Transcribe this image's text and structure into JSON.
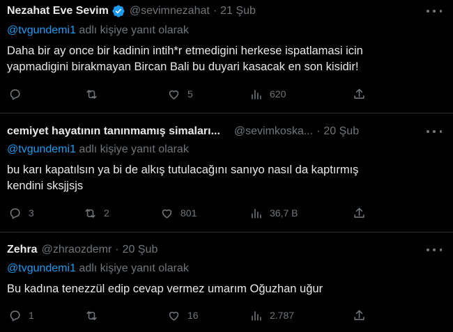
{
  "tweets": [
    {
      "name": "Nezahat Eve Sevim",
      "verified": true,
      "handle": "@sevimnezahat",
      "separator": "·",
      "date": "21 Şub",
      "reply_mention": "@tvgundemi1",
      "reply_suffix": " adlı kişiye yanıt olarak",
      "body_lines": [
        "Daha bir ay once bir kadinin intih*r etmedigini herkese ispatlamasi icin",
        "yapmadigini birakmayan Bircan Bali bu duyari kasacak en son kisidir!"
      ],
      "counts": {
        "replies": "",
        "retweets": "",
        "likes": "5",
        "views": "620"
      }
    },
    {
      "name": "cemiyet hayatının tanınmamış simaları...",
      "verified": false,
      "handle": "@sevimkoska...",
      "separator": "·",
      "date": "20 Şub",
      "reply_mention": "@tvgundemi1",
      "reply_suffix": " adlı kişiye yanıt olarak",
      "body_lines": [
        "bu karı kapatılsın ya bi de alkış tutulacağını sanıyo nasıl da kaptırmış",
        "kendini sksjjsjs"
      ],
      "counts": {
        "replies": "3",
        "retweets": "2",
        "likes": "801",
        "views": "36,7 B"
      }
    },
    {
      "name": "Zehra",
      "verified": false,
      "handle": "@zhraozdemr",
      "separator": "·",
      "date": "20 Şub",
      "reply_mention": "@tvgundemi1",
      "reply_suffix": " adlı kişiye yanıt olarak",
      "body_lines": [
        "Bu kadına tenezzül edip cevap vermez umarım Oğuzhan uğur"
      ],
      "counts": {
        "replies": "1",
        "retweets": "",
        "likes": "16",
        "views": "2.787"
      }
    }
  ],
  "icons": {
    "reply": "reply-icon",
    "retweet": "retweet-icon",
    "like": "heart-icon",
    "views": "views-icon",
    "share": "share-icon",
    "more": "more-icon",
    "verified": "verified-badge-icon"
  },
  "colors": {
    "background": "#000000",
    "text": "#e7e9ea",
    "muted": "#71767b",
    "accent": "#1d9bf0",
    "divider": "#2f3336"
  }
}
